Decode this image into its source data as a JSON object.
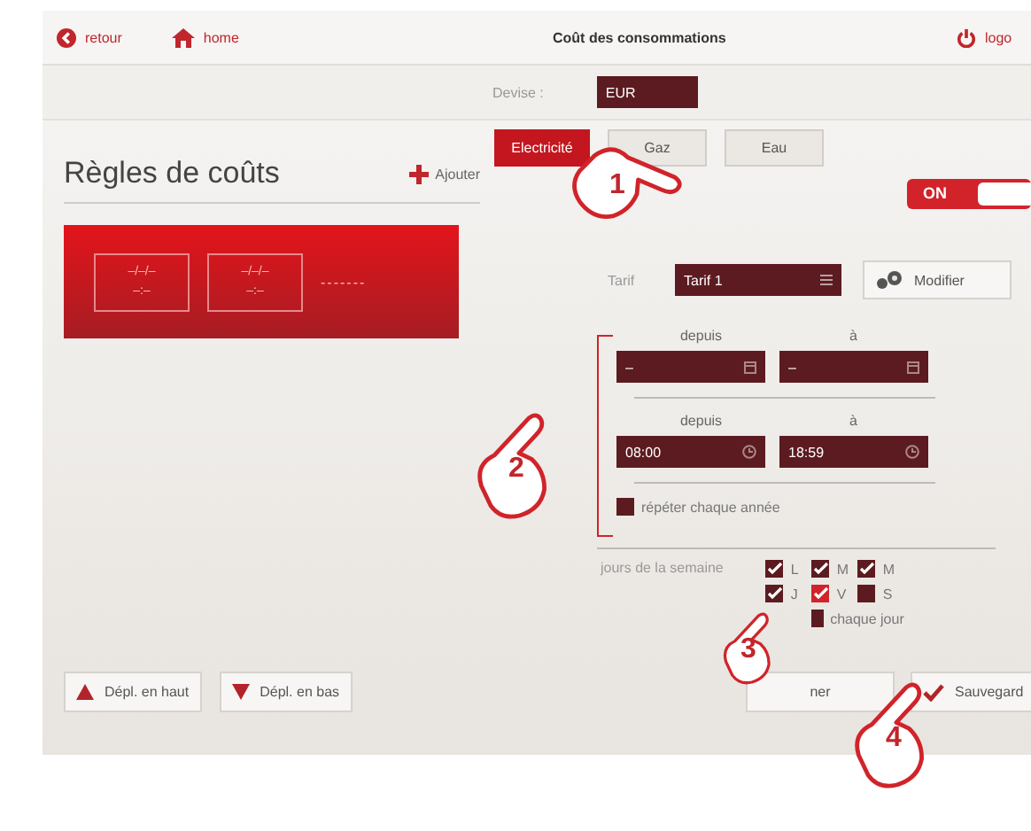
{
  "header": {
    "back": "retour",
    "home": "home",
    "title": "Coût des consommations",
    "logout": "logo"
  },
  "currency": {
    "label": "Devise :",
    "value": "EUR"
  },
  "tabs": [
    {
      "label": "Electricité",
      "selected": true
    },
    {
      "label": "Gaz",
      "selected": false
    },
    {
      "label": "Eau",
      "selected": false
    }
  ],
  "rules_panel": {
    "title": "Règles de coûts",
    "add": "Ajouter",
    "rules": [
      {
        "selected": true,
        "from_date": "–/–/–",
        "from_time": "–:–",
        "to_date": "–/–/–",
        "to_time": "–:–",
        "name": "-------"
      }
    ]
  },
  "move_buttons": [
    {
      "kind": "up",
      "label": "Dépl. en haut"
    },
    {
      "kind": "down",
      "label": "Dépl. en bas"
    }
  ],
  "toggle": {
    "label": "ON",
    "on": true
  },
  "tarif": {
    "label": "Tarif",
    "value": "Tarif 1",
    "modify": "Modifier"
  },
  "date_range": {
    "from_label": "depuis",
    "to_label": "à",
    "from": "–",
    "to": "–"
  },
  "time_range": {
    "from_label": "depuis",
    "to_label": "à",
    "from": "08:00",
    "to": "18:59"
  },
  "repeat": {
    "label": "répéter chaque année",
    "checked": false
  },
  "weekdays": {
    "label": "jours de la semaine",
    "days": [
      {
        "label": "L",
        "checked": true,
        "highlighted": false
      },
      {
        "label": "M",
        "checked": true,
        "highlighted": false
      },
      {
        "label": "M",
        "checked": true,
        "highlighted": false
      },
      {
        "label": "J",
        "checked": true,
        "highlighted": false
      },
      {
        "label": "V",
        "checked": true,
        "highlighted": true
      },
      {
        "label": "S",
        "checked": false,
        "highlighted": false
      },
      {
        "label": "chaque jour",
        "checked": false,
        "highlighted": false
      }
    ]
  },
  "actions": [
    {
      "kind": "cancel",
      "label": "ner"
    },
    {
      "kind": "save",
      "label": "Sauvegard"
    }
  ],
  "callouts": [
    {
      "number": "1"
    },
    {
      "number": "2"
    },
    {
      "number": "3"
    },
    {
      "number": "4"
    }
  ]
}
